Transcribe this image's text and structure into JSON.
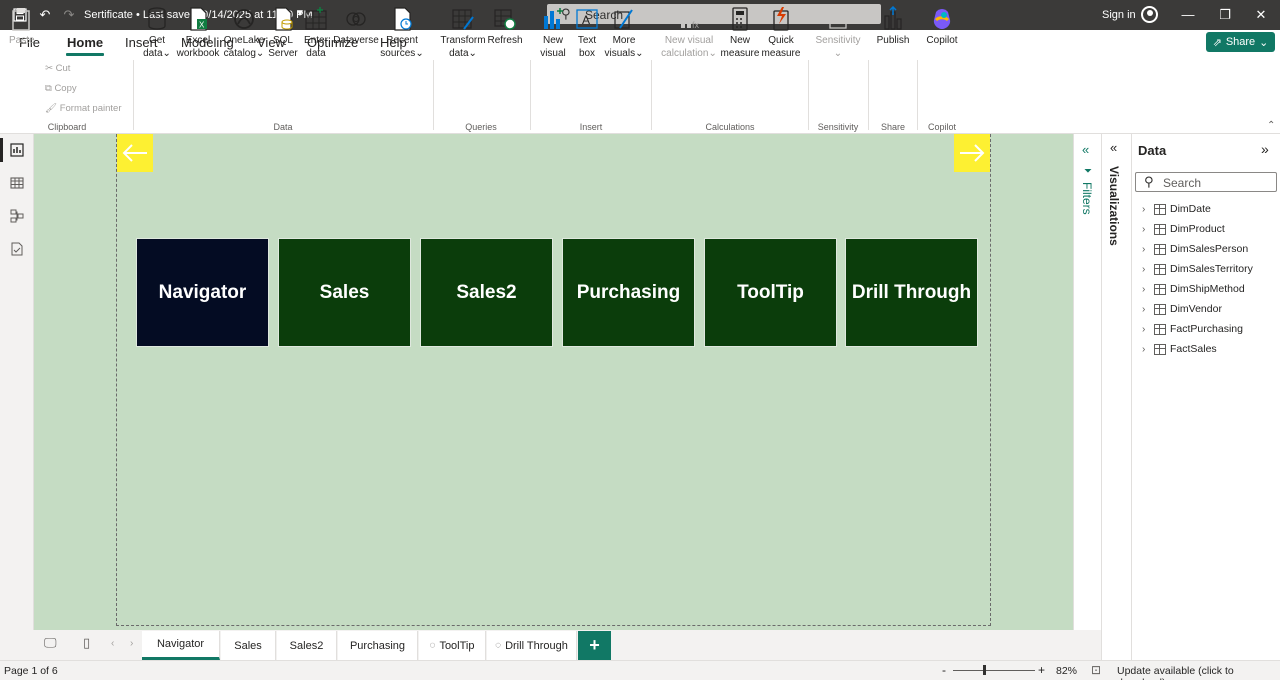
{
  "titlebar": {
    "doc_title": "Sertificate • Last saved: 9/14/2025 at 11:20 PM",
    "search": "Search",
    "signin": "Sign in",
    "icons": [
      "save-icon",
      "undo-icon",
      "redo-icon",
      "minimize-icon",
      "restore-icon",
      "close-icon"
    ]
  },
  "menu": {
    "tabs": [
      "File",
      "Home",
      "Insert",
      "Modeling",
      "View",
      "Optimize",
      "Help"
    ],
    "active": "Home",
    "share": "Share"
  },
  "ribbon": {
    "clipboard": {
      "paste": "Paste",
      "cut": "Cut",
      "copy": "Copy",
      "format_painter": "Format painter",
      "label": "Clipboard"
    },
    "data": {
      "label": "Data",
      "get_data": [
        "Get",
        "data"
      ],
      "excel": [
        "Excel",
        "workbook"
      ],
      "onelake": [
        "OneLake",
        "catalog"
      ],
      "sql": [
        "SQL",
        "Server"
      ],
      "enter": [
        "Enter",
        "data"
      ],
      "dataverse": [
        "Dataverse",
        ""
      ],
      "recent": [
        "Recent",
        "sources"
      ]
    },
    "queries": {
      "label": "Queries",
      "transform": [
        "Transform",
        "data"
      ],
      "refresh": [
        "Refresh",
        ""
      ]
    },
    "insert": {
      "label": "Insert",
      "new_visual": [
        "New",
        "visual"
      ],
      "text_box": [
        "Text",
        "box"
      ],
      "more_visuals": [
        "More",
        "visuals"
      ]
    },
    "calculations": {
      "label": "Calculations",
      "new_visual_calc": [
        "New visual",
        "calculation"
      ],
      "new_measure": [
        "New",
        "measure"
      ],
      "quick_measure": [
        "Quick",
        "measure"
      ]
    },
    "sensitivity": {
      "label": "Sensitivity",
      "btn": "Sensitivity"
    },
    "share": {
      "label": "Share",
      "publish": "Publish"
    },
    "copilot": {
      "label": "Copilot",
      "btn": "Copilot"
    }
  },
  "canvas": {
    "tiles": [
      "Navigator",
      "Sales",
      "Sales2",
      "Purchasing",
      "ToolTip",
      "Drill Through"
    ],
    "active_tile": "Navigator",
    "tile_color": "#0b3d0b",
    "active_tile_color": "#040c23",
    "background": "#c5dcc3",
    "arrow_color": "#fdf032"
  },
  "panes": {
    "filters": "Filters",
    "visualizations": "Visualizations",
    "data_title": "Data",
    "data_search": "Search",
    "tables": [
      "DimDate",
      "DimProduct",
      "DimSalesPerson",
      "DimSalesTerritory",
      "DimShipMethod",
      "DimVendor",
      "FactPurchasing",
      "FactSales"
    ]
  },
  "page_tabs": [
    "Navigator",
    "Sales",
    "Sales2",
    "Purchasing",
    "ToolTip",
    "Drill Through"
  ],
  "status": {
    "page": "Page 1 of 6",
    "zoom": "82%",
    "update": "Update available (click to download)"
  }
}
